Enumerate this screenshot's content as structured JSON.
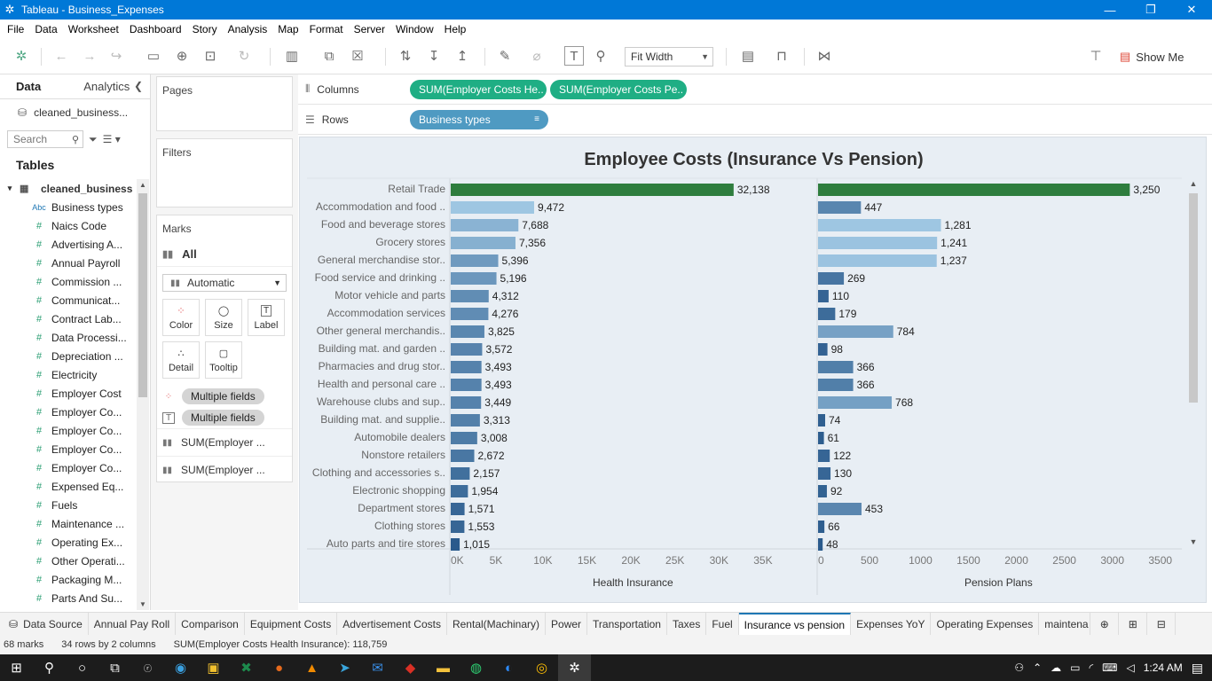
{
  "window": {
    "title": "Tableau - Business_Expenses"
  },
  "menu": [
    "File",
    "Data",
    "Worksheet",
    "Dashboard",
    "Story",
    "Analysis",
    "Map",
    "Format",
    "Server",
    "Window",
    "Help"
  ],
  "toolbar": {
    "fit": "Fit Width",
    "show_me": "Show Me"
  },
  "left": {
    "tab_data": "Data",
    "tab_analytics": "Analytics",
    "datasource": "cleaned_business...",
    "search_placeholder": "Search",
    "tables_heading": "Tables",
    "table_name": "cleaned_business",
    "fields": [
      {
        "type": "Abc",
        "name": "Business types"
      },
      {
        "type": "#",
        "name": "Naics Code"
      },
      {
        "type": "#",
        "name": "Advertising A..."
      },
      {
        "type": "#",
        "name": "Annual Payroll"
      },
      {
        "type": "#",
        "name": "Commission ..."
      },
      {
        "type": "#",
        "name": "Communicat..."
      },
      {
        "type": "#",
        "name": "Contract Lab..."
      },
      {
        "type": "#",
        "name": "Data Processi..."
      },
      {
        "type": "#",
        "name": "Depreciation ..."
      },
      {
        "type": "#",
        "name": "Electricity"
      },
      {
        "type": "#",
        "name": "Employer Cost"
      },
      {
        "type": "#",
        "name": "Employer Co..."
      },
      {
        "type": "#",
        "name": "Employer Co..."
      },
      {
        "type": "#",
        "name": "Employer Co..."
      },
      {
        "type": "#",
        "name": "Employer Co..."
      },
      {
        "type": "#",
        "name": "Expensed Eq..."
      },
      {
        "type": "#",
        "name": "Fuels"
      },
      {
        "type": "#",
        "name": "Maintenance ..."
      },
      {
        "type": "#",
        "name": "Operating Ex..."
      },
      {
        "type": "#",
        "name": "Other Operati..."
      },
      {
        "type": "#",
        "name": "Packaging M..."
      },
      {
        "type": "#",
        "name": "Parts And Su..."
      }
    ]
  },
  "cards": {
    "pages": "Pages",
    "filters": "Filters",
    "marks": "Marks",
    "marks_all": "All",
    "mark_type": "Automatic",
    "buttons": [
      "Color",
      "Size",
      "Label",
      "Detail",
      "Tooltip"
    ],
    "multi1": "Multiple fields",
    "multi2": "Multiple fields",
    "sum1": "SUM(Employer ...",
    "sum2": "SUM(Employer ..."
  },
  "shelves": {
    "columns_label": "Columns",
    "rows_label": "Rows",
    "col_pill1": "SUM(Employer Costs He..",
    "col_pill2": "SUM(Employer Costs Pe..",
    "row_pill": "Business types"
  },
  "chart_data": {
    "type": "bar",
    "title": "Employee Costs (Insurance Vs Pension)",
    "orientation": "horizontal",
    "categories": [
      "Retail Trade",
      "Accommodation and food ..",
      "Food and beverage stores",
      "Grocery stores",
      "General merchandise stor..",
      "Food service and drinking ..",
      "Motor vehicle and parts",
      "Accommodation services",
      "Other general merchandis..",
      "Building mat. and garden ..",
      "Pharmacies and drug stor..",
      "Health and personal care ..",
      "Warehouse clubs and sup..",
      "Building mat. and supplie..",
      "Automobile dealers",
      "Nonstore retailers",
      "Clothing and accessories s..",
      "Electronic shopping",
      "Department stores",
      "Clothing stores",
      "Auto parts and tire stores"
    ],
    "panels": [
      {
        "name": "Health Insurance",
        "xlabel": "Health Insurance",
        "xlim": [
          0,
          38000
        ],
        "ticks": [
          0,
          5000,
          10000,
          15000,
          20000,
          25000,
          30000,
          35000
        ],
        "tick_labels": [
          "0K",
          "5K",
          "10K",
          "15K",
          "20K",
          "25K",
          "30K",
          "35K"
        ],
        "values": [
          32138,
          9472,
          7688,
          7356,
          5396,
          5196,
          4312,
          4276,
          3825,
          3572,
          3493,
          3493,
          3449,
          3313,
          3008,
          2672,
          2157,
          1954,
          1571,
          1553,
          1015
        ],
        "value_labels": [
          "32,138",
          "9,472",
          "7,688",
          "7,356",
          "5,396",
          "5,196",
          "4,312",
          "4,276",
          "3,825",
          "3,572",
          "3,493",
          "3,493",
          "3,449",
          "3,313",
          "3,008",
          "2,672",
          "2,157",
          "1,954",
          "1,571",
          "1,553",
          "1,015"
        ]
      },
      {
        "name": "Pension Plans",
        "xlabel": "Pension Plans",
        "xlim": [
          0,
          3700
        ],
        "ticks": [
          0,
          500,
          1000,
          1500,
          2000,
          2500,
          3000,
          3500
        ],
        "tick_labels": [
          "0",
          "500",
          "1000",
          "1500",
          "2000",
          "2500",
          "3000",
          "3500"
        ],
        "values": [
          3250,
          447,
          1281,
          1241,
          1237,
          269,
          110,
          179,
          784,
          98,
          366,
          366,
          768,
          74,
          61,
          122,
          130,
          92,
          453,
          66,
          48
        ],
        "value_labels": [
          "3,250",
          "447",
          "1,281",
          "1,241",
          "1,237",
          "269",
          "110",
          "179",
          "784",
          "98",
          "366",
          "366",
          "768",
          "74",
          "61",
          "122",
          "130",
          "92",
          "453",
          "66",
          "48"
        ]
      }
    ],
    "colors": {
      "highlight": "#2e7d3e",
      "dark": "#2a5a8c",
      "light": "#9ec6e2"
    },
    "grid": false
  },
  "sheet_tabs": {
    "data_source": "Data Source",
    "tabs": [
      "Annual Pay Roll",
      "Comparison",
      "Equipment Costs",
      "Advertisement Costs",
      "Rental(Machinary)",
      "Power",
      "Transportation",
      "Taxes",
      "Fuel",
      "Insurance vs pension",
      "Expenses YoY",
      "Operating Expenses",
      "maintena"
    ],
    "active": "Insurance vs pension"
  },
  "status": {
    "marks": "68 marks",
    "rows_cols": "34 rows by 2 columns",
    "sum": "SUM(Employer Costs Health Insurance): 118,759"
  },
  "taskbar": {
    "time": "1:24 AM"
  }
}
